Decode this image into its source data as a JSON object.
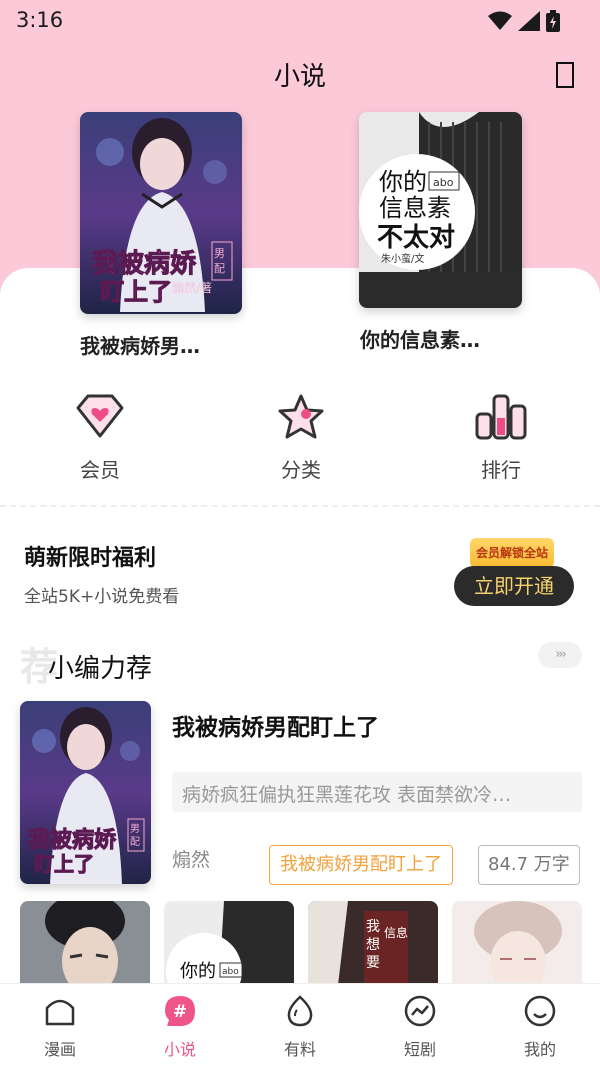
{
  "status_bar": {
    "time": "3:16"
  },
  "header": {
    "title": "小说"
  },
  "top_books": [
    {
      "title": "我被病娇男…",
      "cover_text": "我被病娇男配盯上了",
      "cover_author": "煽然/著",
      "cover_badge": "男配"
    },
    {
      "title": "你的信息素…",
      "cover_text": "你的信息素",
      "cover_text2": "不太对",
      "cover_tag": "abo",
      "cover_author": "朱小蛮/文"
    }
  ],
  "shortcuts": [
    {
      "label": "会员",
      "icon": "diamond-heart-icon"
    },
    {
      "label": "分类",
      "icon": "star-icon"
    },
    {
      "label": "排行",
      "icon": "ranking-bars-icon"
    }
  ],
  "promo": {
    "title": "萌新限时福利",
    "subtitle": "全站5K+小说免费看",
    "tag": "会员解锁全站",
    "button": "立即开通"
  },
  "section": {
    "bg_char": "荐",
    "title": "小编力荐",
    "more": "›››"
  },
  "featured": {
    "title": "我被病娇男配盯上了",
    "description": "病娇疯狂偏执狂黑莲花攻 表面禁欲冷…",
    "author": "煽然",
    "tag": "我被病娇男配盯上了",
    "word_count": "84.7 万字"
  },
  "bottom_nav": [
    {
      "label": "漫画",
      "icon": "house-icon",
      "active": false
    },
    {
      "label": "小说",
      "icon": "hash-icon",
      "active": true
    },
    {
      "label": "有料",
      "icon": "egg-icon",
      "active": false
    },
    {
      "label": "短剧",
      "icon": "trend-circle-icon",
      "active": false
    },
    {
      "label": "我的",
      "icon": "smile-icon",
      "active": false
    }
  ],
  "colors": {
    "pink_bg": "#fbc9d8",
    "accent": "#f0558a",
    "tag_orange": "#f2a13b"
  }
}
